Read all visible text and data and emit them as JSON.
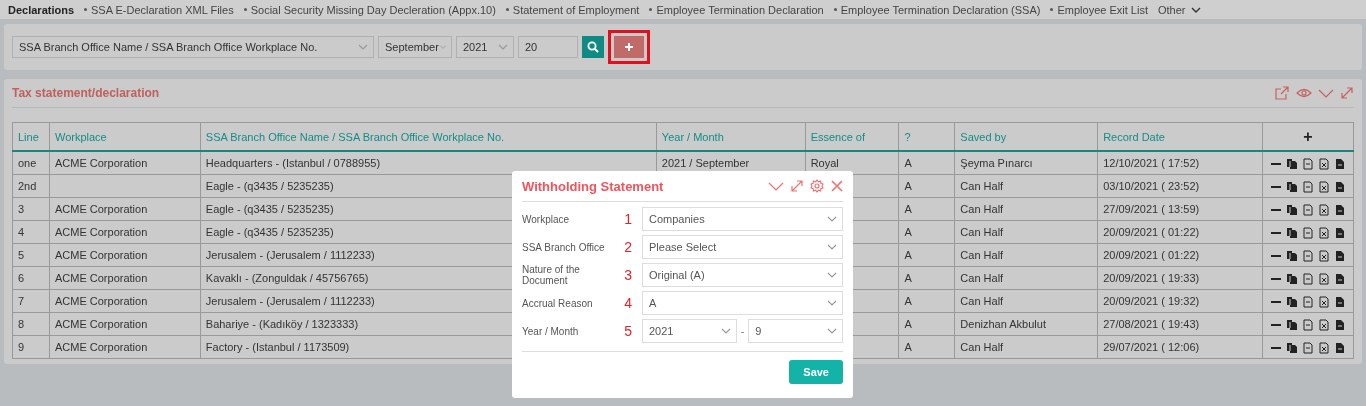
{
  "nav": [
    {
      "label": "Declarations",
      "selected": true,
      "kind": "plain"
    },
    {
      "label": "SSA E-Declaration XML Files",
      "selected": false,
      "kind": "bullet"
    },
    {
      "label": "Social Security Missing Day Decleration (Appx.10)",
      "selected": false,
      "kind": "bullet"
    },
    {
      "label": "Statement of Employment",
      "selected": false,
      "kind": "bullet"
    },
    {
      "label": "Employee Termination Declaration",
      "selected": false,
      "kind": "bullet"
    },
    {
      "label": "Employee Termination Declaration (SSA)",
      "selected": false,
      "kind": "bullet"
    },
    {
      "label": "Employee Exit List",
      "selected": false,
      "kind": "bullet"
    },
    {
      "label": "Other",
      "selected": false,
      "kind": "dropdown"
    }
  ],
  "filter": {
    "branch": "SSA Branch Office Name / SSA Branch Office Workplace No.",
    "month": "September",
    "year": "2021",
    "count": "20",
    "add_highlighted": true
  },
  "panel": {
    "title": "Tax statement/declaration",
    "table": {
      "columns": [
        "Line",
        "Workplace",
        "SSA Branch Office Name / SSA Branch Office Workplace No.",
        "Year / Month",
        "Essence of",
        "?",
        "Saved by",
        "Record Date"
      ],
      "add_column": "+",
      "rows": [
        {
          "line": "one",
          "workplace": "ACME Corporation",
          "branch": "Headquarters - (Istanbul / 0788955)",
          "year_month": "2021 / September",
          "essence": "Royal",
          "q": "A",
          "saved_by": "Şeyma Pınarcı",
          "record_date": "12/10/2021 ( 17:52)"
        },
        {
          "line": "2nd",
          "branch": "Eagle - (q3435 / 5235235)",
          "q": "A",
          "saved_by": "Can Half",
          "record_date": "03/10/2021 ( 23:52)"
        },
        {
          "line": "3",
          "workplace": "ACME Corporation",
          "branch": "Eagle - (q3435 / 5235235)",
          "q": "A",
          "saved_by": "Can Half",
          "record_date": "27/09/2021 ( 13:59)"
        },
        {
          "line": "4",
          "workplace": "ACME Corporation",
          "branch": "Eagle - (q3435 / 5235235)",
          "q": "A",
          "saved_by": "Can Half",
          "record_date": "20/09/2021 ( 01:22)"
        },
        {
          "line": "5",
          "workplace": "ACME Corporation",
          "branch": "Jerusalem - (Jerusalem / 1112233)",
          "q": "A",
          "saved_by": "Can Half",
          "record_date": "20/09/2021 ( 01:22)"
        },
        {
          "line": "6",
          "workplace": "ACME Corporation",
          "branch": "Kavaklı - (Zonguldak / 45756765)",
          "q": "A",
          "saved_by": "Can Half",
          "record_date": "20/09/2021 ( 19:33)"
        },
        {
          "line": "7",
          "workplace": "ACME Corporation",
          "branch": "Jerusalem - (Jerusalem / 1112233)",
          "q": "A",
          "saved_by": "Can Half",
          "record_date": "20/09/2021 ( 19:32)"
        },
        {
          "line": "8",
          "workplace": "ACME Corporation",
          "branch": "Bahariye - (Kadıköy / 1323333)",
          "q": "A",
          "saved_by": "Denizhan Akbulut",
          "record_date": "27/08/2021 ( 19:43)"
        },
        {
          "line": "9",
          "workplace": "ACME Corporation",
          "branch": "Factory - (Istanbul / 1173509)",
          "q": "A",
          "saved_by": "Can Half",
          "record_date": "29/07/2021 ( 12:06)"
        }
      ]
    }
  },
  "modal": {
    "title": "Withholding Statement",
    "fields": [
      {
        "kind": "select",
        "label": "Workplace",
        "number": "1",
        "value": "Companies"
      },
      {
        "kind": "select",
        "label": "SSA Branch Office",
        "number": "2",
        "value": "Please Select"
      },
      {
        "kind": "select",
        "label": "Nature of the Document",
        "number": "3",
        "value": "Original (A)"
      },
      {
        "kind": "select",
        "label": "Accrual Reason",
        "number": "4",
        "value": "A"
      },
      {
        "kind": "range",
        "label": "Year / Month",
        "number": "5",
        "value": "2021",
        "separator": "-",
        "value2": "9"
      }
    ],
    "save": "Save"
  }
}
